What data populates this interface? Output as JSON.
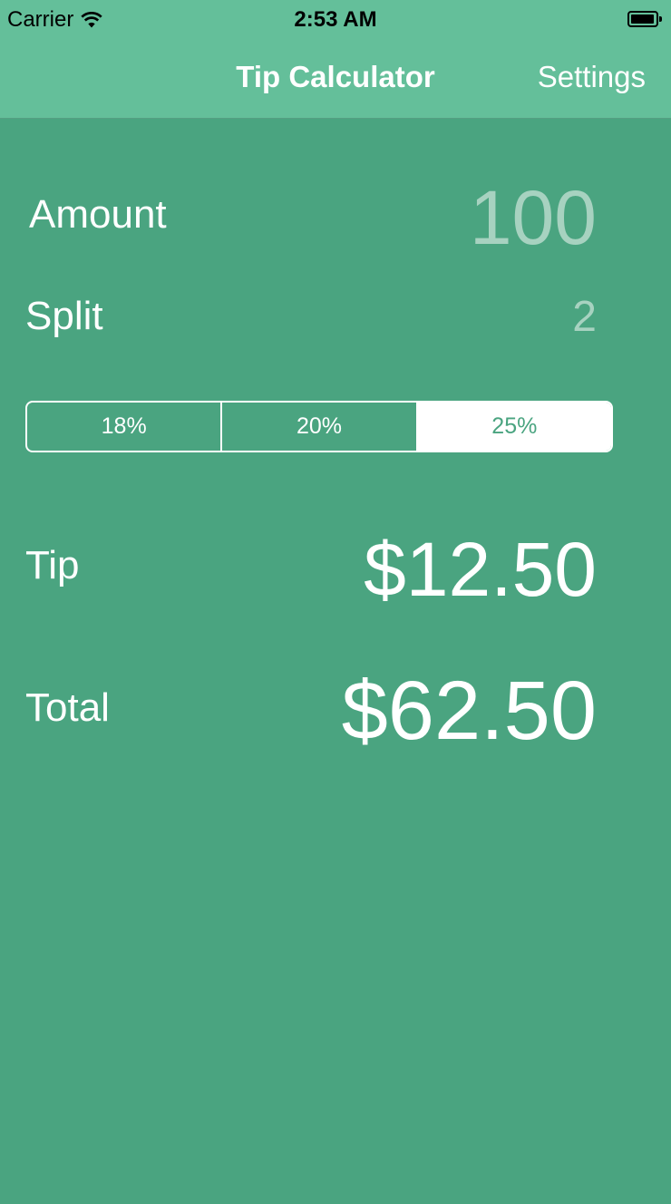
{
  "status_bar": {
    "carrier": "Carrier",
    "wifi_icon": "wifi-icon",
    "time": "2:53 AM",
    "battery_icon": "battery-icon"
  },
  "nav": {
    "title": "Tip Calculator",
    "settings_label": "Settings"
  },
  "form": {
    "amount_label": "Amount",
    "amount_value": "100",
    "split_label": "Split",
    "split_value": "2"
  },
  "tip_options": [
    "18%",
    "20%",
    "25%"
  ],
  "selected_tip": "25%",
  "results": {
    "tip_label": "Tip",
    "tip_value": "$12.50",
    "total_label": "Total",
    "total_value": "$62.50"
  },
  "colors": {
    "background": "#4aa480",
    "header": "#64bf9a",
    "muted_value": "#a7d2c0",
    "text": "#ffffff"
  }
}
